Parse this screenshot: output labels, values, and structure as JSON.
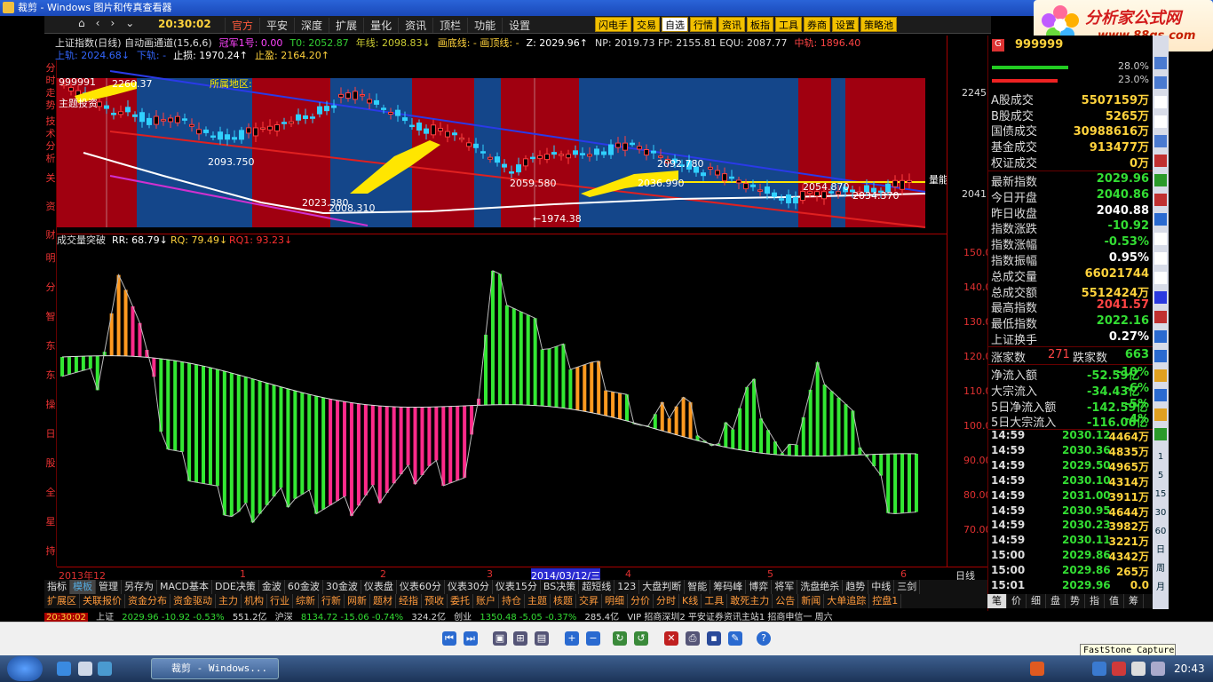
{
  "window": {
    "title": "裁剪 - Windows 图片和传真查看器"
  },
  "topmenu": {
    "clock": "20:30:02",
    "items": [
      "官方",
      "平安",
      "深度",
      "扩展",
      "量化",
      "资讯",
      "顶栏",
      "功能",
      "设置"
    ],
    "buttons": [
      "闪电手",
      "交易",
      "自选",
      "行情",
      "资讯",
      "板指",
      "工具",
      "券商",
      "设置",
      "策略池"
    ]
  },
  "logo": {
    "line1": "分析家公式网",
    "line2": "www.88gs.com"
  },
  "header": {
    "row1": [
      {
        "text": "上证指数(日线) 自动画通道(15,6,6)",
        "color": "#dddddd"
      },
      {
        "text": "冠军1号: 0.00",
        "color": "#ff44ff"
      },
      {
        "text": "T0: 2052.87",
        "color": "#33cc33"
      },
      {
        "text": "年线: 2098.83↓",
        "color": "#cccc33"
      },
      {
        "text": "画底线: - 画顶线: -",
        "color": "#ffd23c"
      },
      {
        "text": "Z: 2029.96↑",
        "color": "#ffffff"
      },
      {
        "text": "NP: 2019.73 FP: 2155.81 EQU: 2087.77",
        "color": "#dddddd"
      },
      {
        "text": "中轨: 1896.40",
        "color": "#ff4444"
      }
    ],
    "row2": [
      {
        "text": "上轨: 2024.68↓",
        "color": "#3366ff"
      },
      {
        "text": "下轨: -",
        "color": "#3366ff"
      },
      {
        "text": "止损: 1970.24↑",
        "color": "#ffffff"
      },
      {
        "text": "止盈: 2164.20↑",
        "color": "#ffd23c"
      }
    ]
  },
  "leftbar": {
    "chars": [
      "分",
      "时",
      "走",
      "势",
      "技",
      "术",
      "分",
      "析",
      "关",
      "资",
      "财"
    ],
    "subchars": [
      "明",
      "分",
      "智",
      "东",
      "东",
      "操",
      "日",
      "股",
      "全",
      "星",
      "持"
    ]
  },
  "mainchart": {
    "labels": {
      "region": "所属地区:",
      "top_left": "999991",
      "top_price": "2260.37",
      "low1": "2023.380",
      "low2": "2008.310",
      "mid1": "2059.580",
      "mid2": "2036.990",
      "mid3": "2054.870",
      "low3": "2034.370",
      "low_mark": "←1974.38",
      "quote1": "2093.750",
      "quote2": "2092.780",
      "right_tag": "量能",
      "sub_title": "主题投资"
    },
    "axis_ticks": [
      "2245",
      "2041"
    ]
  },
  "subchart": {
    "title": "成交量突破",
    "rr": "RR: 68.79↓",
    "rq": "RQ: 79.49↓",
    "rq1": "RQ1: 93.23↓",
    "axis_ticks": [
      "150.00",
      "140.00",
      "130.00",
      "120.00",
      "110.00",
      "100.00",
      "90.00",
      "80.00",
      "70.00"
    ]
  },
  "dateaxis": {
    "labels": [
      "2013年12",
      "1",
      "2",
      "3",
      "2014/03/12/三",
      "4",
      "5",
      "6"
    ],
    "period": "日线"
  },
  "tabs1": [
    "指标",
    "模板",
    "管理",
    "另存为",
    "MACD基本",
    "DDE决策",
    "金波",
    "60金波",
    "30金波",
    "仪表盘",
    "仪表60分",
    "仪表30分",
    "仪表15分",
    "BS决策",
    "超短线",
    "123",
    "大盘判断",
    "智能",
    "筹码峰",
    "博弈",
    "将军",
    "洗盘绝杀",
    "趋势",
    "中线",
    "三剑"
  ],
  "tabs2": [
    "扩展区",
    "关联报价",
    "资金分布",
    "资金驱动",
    "主力",
    "机构",
    "行业",
    "综新",
    "行新",
    "网新",
    "题材",
    "经指",
    "预收",
    "委托",
    "账户",
    "持仓",
    "主题",
    "核题",
    "交昇",
    "明细",
    "分价",
    "分时",
    "K线",
    "工具",
    "敢死主力",
    "公告",
    "新闻",
    "大单追踪",
    "控盘1"
  ],
  "status": {
    "time": "20:30:02",
    "sh_label": "上证",
    "sh": "2029.96 -10.92 -0.53%",
    "sh_amount": "551.2亿",
    "sz_label": "沪深",
    "sz": "8134.72 -15.06 -0.74%",
    "sz_amount": "324.2亿",
    "cyb_label": "创业",
    "cyb": "1350.48 -5.05 -0.37%",
    "cyb_amount": "285.4亿",
    "ticker": "VIP 招商深圳2  平安证券资讯主站1  招商申信一  周六"
  },
  "rightpanel": {
    "code": "G",
    "codenum": "999999",
    "bars": [
      {
        "pct": "28.0%",
        "color": "#22cc22",
        "frac": 0.72
      },
      {
        "pct": "23.0%",
        "color": "#ee2222",
        "frac": 0.62
      }
    ],
    "quotes1": [
      {
        "k": "A股成交",
        "v": "5507159万",
        "c": "#ffd23c"
      },
      {
        "k": "B股成交",
        "v": "5265万",
        "c": "#ffd23c"
      },
      {
        "k": "国债成交",
        "v": "30988616万",
        "c": "#ffd23c"
      },
      {
        "k": "基金成交",
        "v": "913477万",
        "c": "#ffd23c"
      },
      {
        "k": "权证成交",
        "v": "0万",
        "c": "#ffd23c"
      }
    ],
    "quotes2": [
      {
        "k": "最新指数",
        "v": "2029.96",
        "c": "#33dd33"
      },
      {
        "k": "今日开盘",
        "v": "2040.86",
        "c": "#33dd33"
      },
      {
        "k": "昨日收盘",
        "v": "2040.88",
        "c": "#ffffff"
      },
      {
        "k": "指数涨跌",
        "v": "-10.92",
        "c": "#33dd33"
      },
      {
        "k": "指数涨幅",
        "v": "-0.53%",
        "c": "#33dd33"
      },
      {
        "k": "指数振幅",
        "v": "0.95%",
        "c": "#ffffff"
      },
      {
        "k": "总成交量",
        "v": "66021744",
        "c": "#ffd23c"
      },
      {
        "k": "总成交额",
        "v": "5512424万",
        "c": "#ffd23c"
      },
      {
        "k": "最高指数",
        "v": "2041.57",
        "c": "#ff4444"
      },
      {
        "k": "最低指数",
        "v": "2022.16",
        "c": "#33dd33"
      },
      {
        "k": "上证换手",
        "v": "0.27%",
        "c": "#ffffff"
      }
    ],
    "updown": {
      "up_label": "涨家数",
      "up": "271",
      "down_label": "跌家数",
      "down": "663"
    },
    "flows": [
      {
        "k": "净流入额",
        "v": "-52.59亿",
        "p": "-10%"
      },
      {
        "k": "大宗流入",
        "v": "-34.43亿",
        "p": "-6%"
      },
      {
        "k": "5日净流入额",
        "v": "-142.59亿",
        "p": "-5%"
      },
      {
        "k": "5日大宗流入",
        "v": "-116.06亿",
        "p": "-4%"
      }
    ],
    "ticks": [
      {
        "t": "14:59",
        "p": "2030.12",
        "v": "4464万"
      },
      {
        "t": "14:59",
        "p": "2030.36",
        "v": "4835万"
      },
      {
        "t": "14:59",
        "p": "2029.50",
        "v": "4965万"
      },
      {
        "t": "14:59",
        "p": "2030.10",
        "v": "4314万"
      },
      {
        "t": "14:59",
        "p": "2031.00",
        "v": "3911万"
      },
      {
        "t": "14:59",
        "p": "2030.95",
        "v": "4644万"
      },
      {
        "t": "14:59",
        "p": "2030.23",
        "v": "3982万"
      },
      {
        "t": "14:59",
        "p": "2030.11",
        "v": "3221万"
      },
      {
        "t": "15:00",
        "p": "2029.86",
        "v": "4342万"
      },
      {
        "t": "15:00",
        "p": "2029.86",
        "v": "265万"
      },
      {
        "t": "15:01",
        "p": "2029.96",
        "v": "0.0"
      }
    ],
    "tabs": [
      "笔",
      "价",
      "细",
      "盘",
      "势",
      "指",
      "值",
      "筹"
    ]
  },
  "toolstrip": {
    "nums": [
      "1",
      "5",
      "15",
      "30",
      "60",
      "日",
      "周",
      "月"
    ]
  },
  "viewer": {
    "tooltip": "FastStone Capture"
  },
  "taskbar": {
    "item": "裁剪 - Windows...",
    "clock": "20:43"
  }
}
